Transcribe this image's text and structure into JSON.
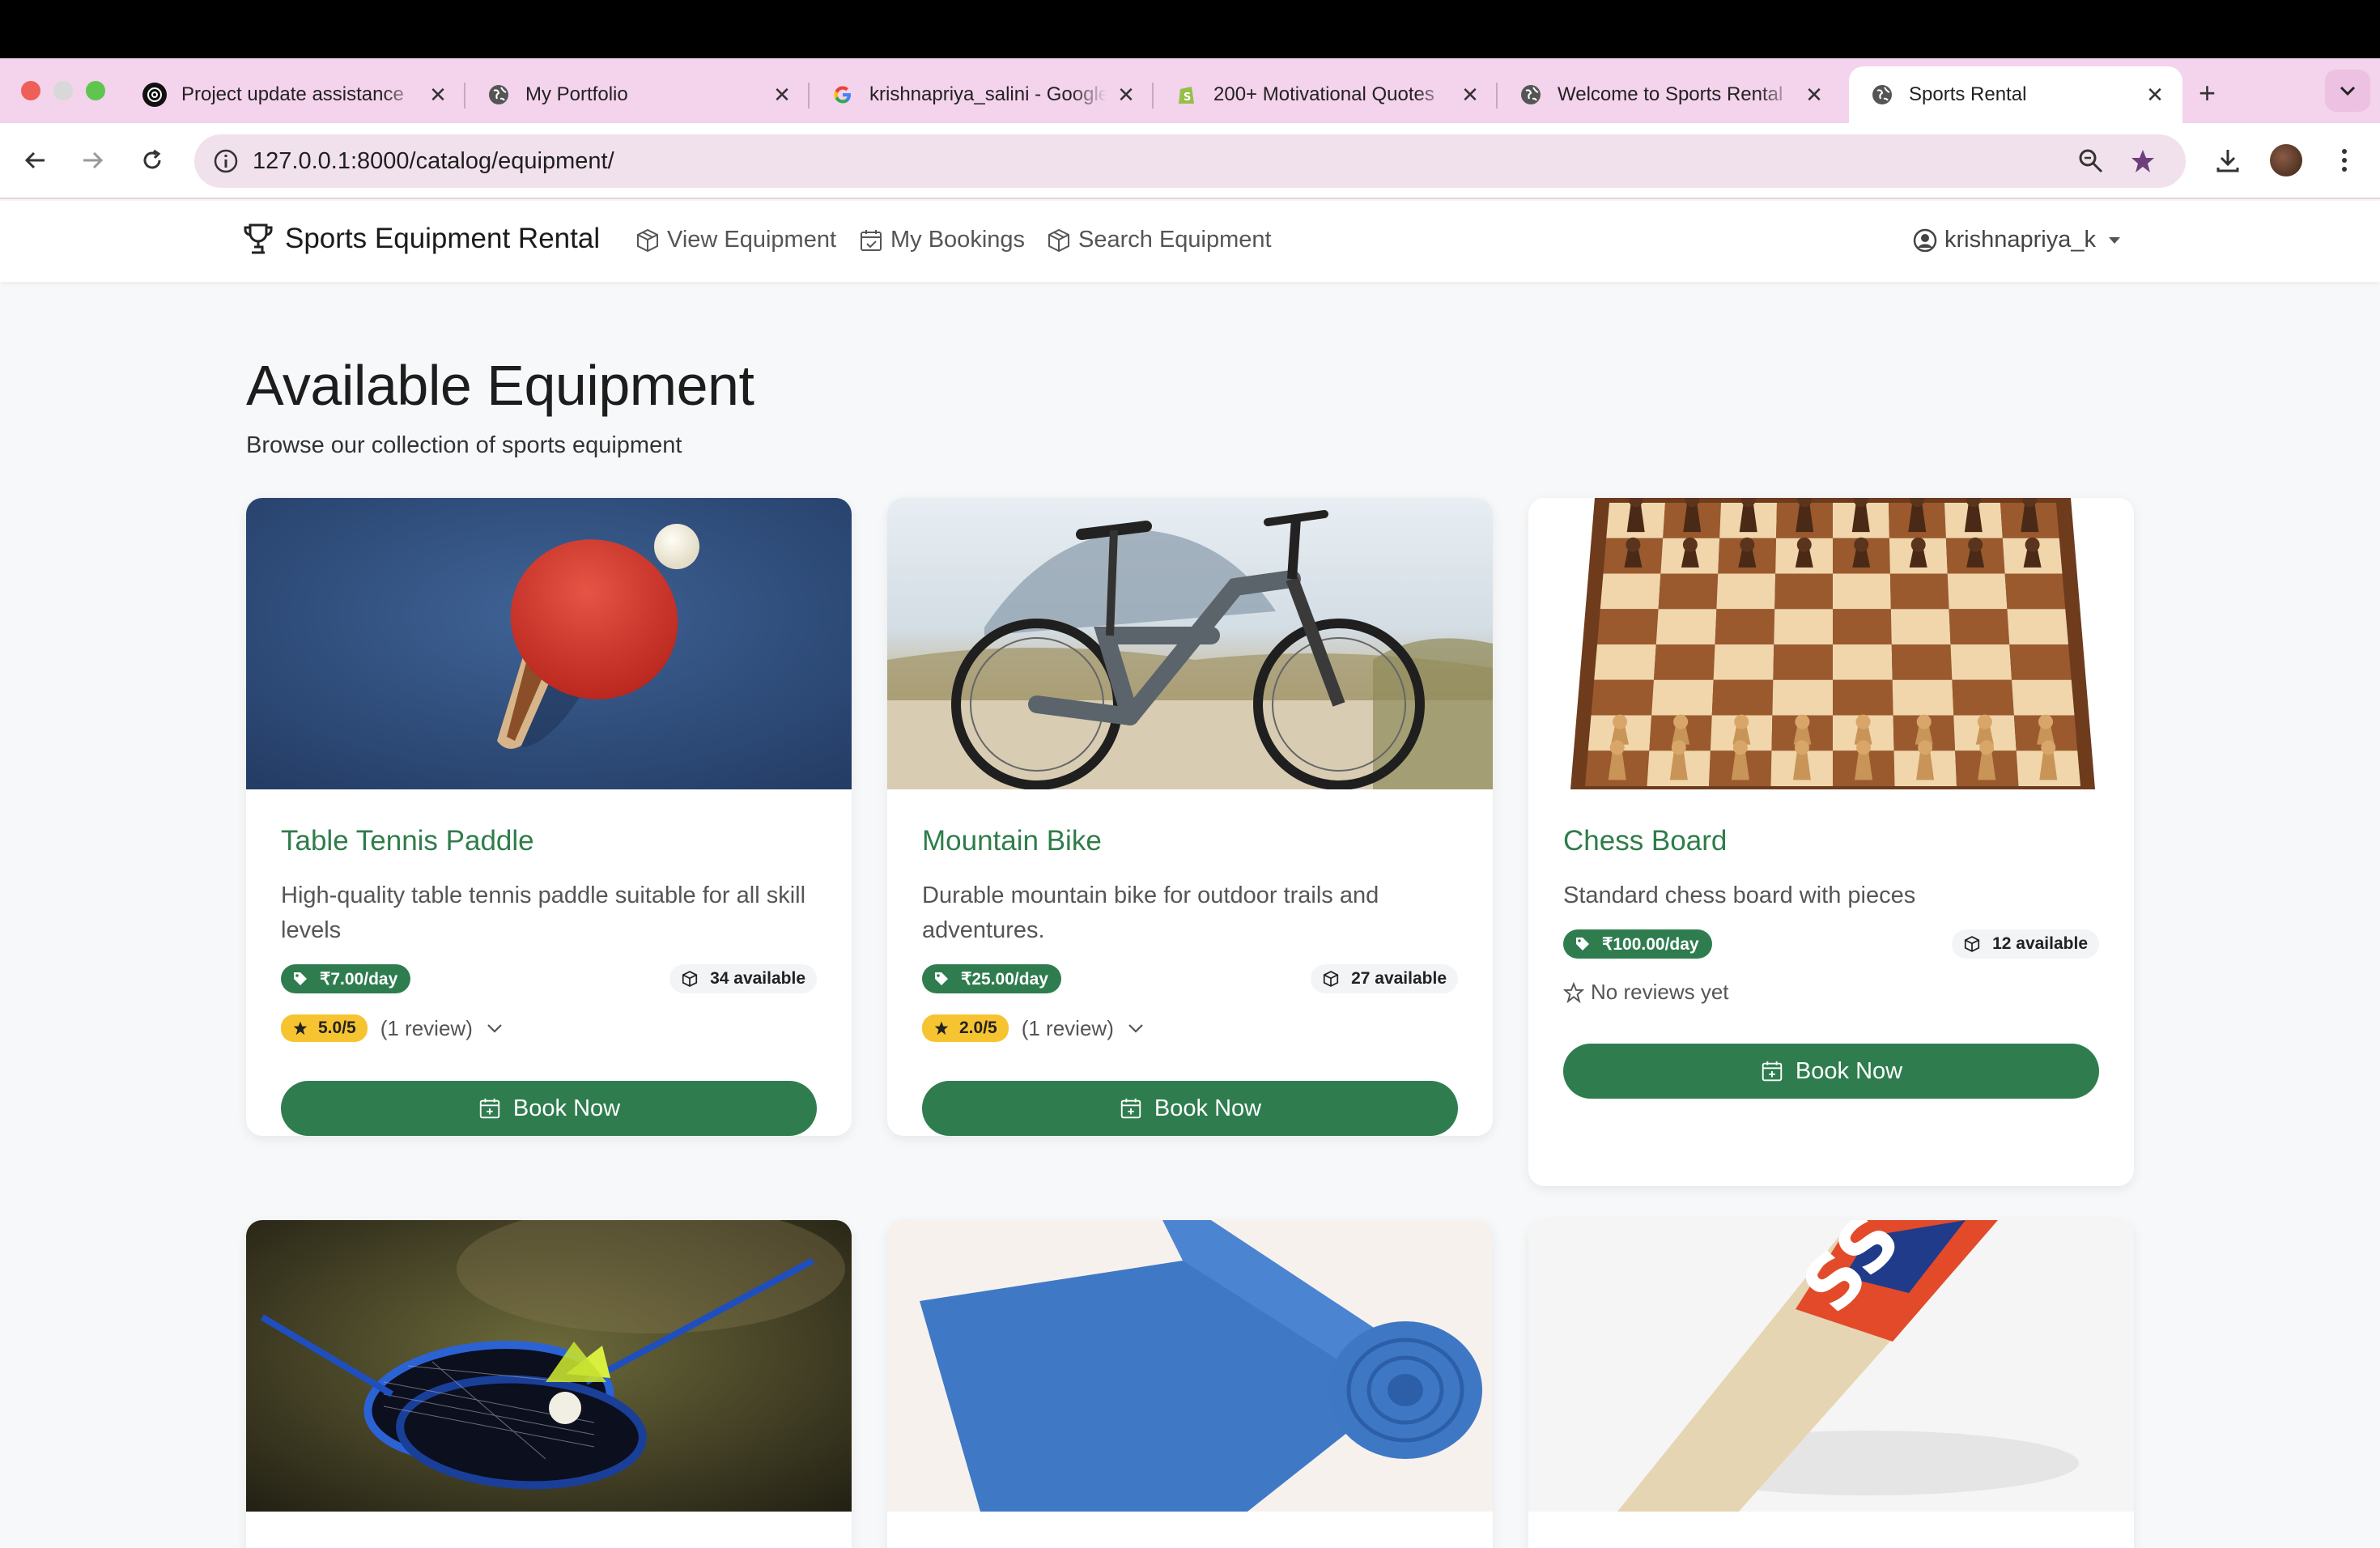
{
  "browser": {
    "tabs": [
      {
        "title": "Project update assistance",
        "favicon": "openai-icon"
      },
      {
        "title": "My Portfolio",
        "favicon": "globe-icon"
      },
      {
        "title": "krishnapriya_salini - Google Search",
        "favicon": "google-icon"
      },
      {
        "title": "200+ Motivational Quotes",
        "favicon": "shopify-icon"
      },
      {
        "title": "Welcome to Sports Rental",
        "favicon": "globe-icon"
      },
      {
        "title": "Sports Rental",
        "favicon": "globe-icon",
        "active": true
      }
    ],
    "url": "127.0.0.1:8000/catalog/equipment/"
  },
  "site": {
    "brand": "Sports Equipment Rental",
    "nav": [
      "View Equipment",
      "My Bookings",
      "Search Equipment"
    ],
    "user": "krishnapriya_k"
  },
  "page": {
    "title": "Available Equipment",
    "subtitle": "Browse our collection of sports equipment"
  },
  "equipment": [
    {
      "name": "Table Tennis Paddle",
      "description": "High-quality table tennis paddle suitable for all skill levels",
      "price": "₹7.00/day",
      "available": "34 available",
      "rating": "5.0/5",
      "reviews": "(1 review)"
    },
    {
      "name": "Mountain Bike",
      "description": "Durable mountain bike for outdoor trails and adventures.",
      "price": "₹25.00/day",
      "available": "27 available",
      "rating": "2.0/5",
      "reviews": "(1 review)"
    },
    {
      "name": "Chess Board",
      "description": "Standard chess board with pieces",
      "price": "₹100.00/day",
      "available": "12 available",
      "no_reviews": "No reviews yet"
    }
  ],
  "book_label": "Book Now",
  "colors": {
    "primary_green": "#2f7d4f",
    "rating_yellow": "#f6c430",
    "tab_strip": "#f4d3ec"
  }
}
